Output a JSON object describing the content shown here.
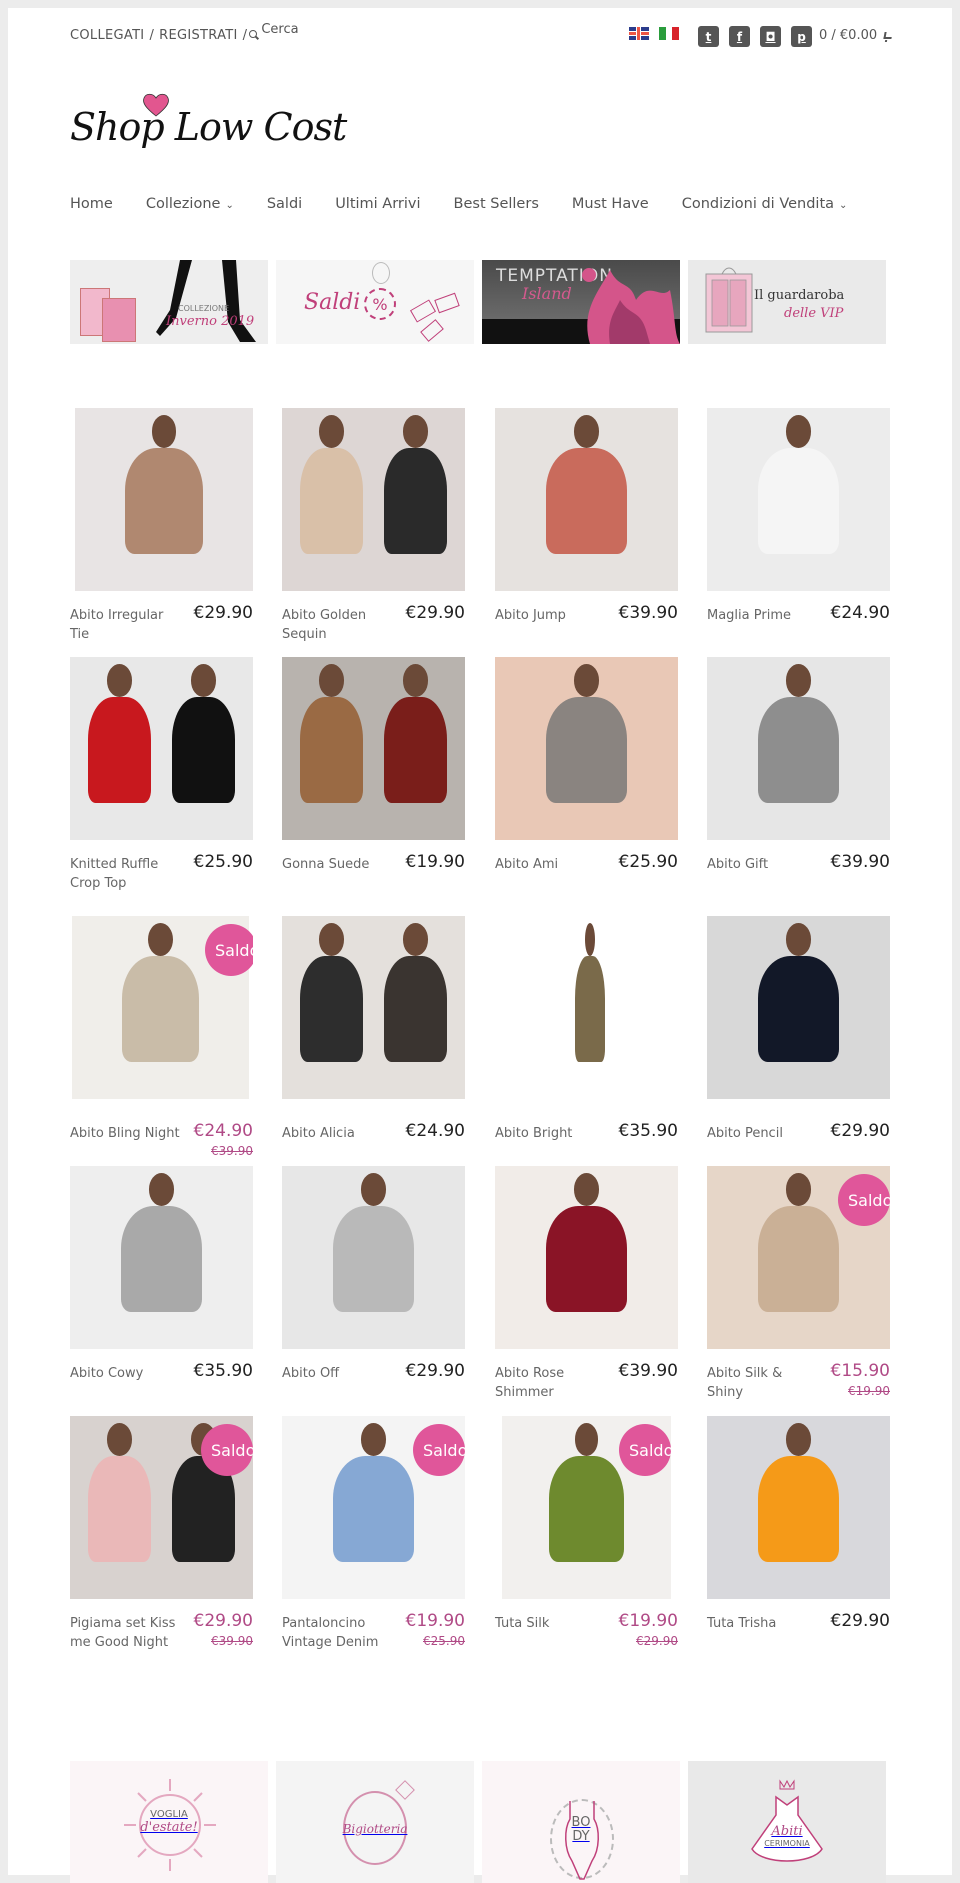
{
  "topbar": {
    "login": "COLLEGATI",
    "separator": "/",
    "register": "REGISTRATI",
    "separator2": "/",
    "search_placeholder": "Cerca",
    "flags": [
      "English",
      "Italiano"
    ],
    "socials": [
      {
        "name": "twitter",
        "glyph": "t"
      },
      {
        "name": "facebook",
        "glyph": "f"
      },
      {
        "name": "instagram",
        "glyph": "◘"
      },
      {
        "name": "pinterest",
        "glyph": "p"
      }
    ],
    "cart": "0 / €0.00"
  },
  "logo": {
    "text": "Shop Low Cost"
  },
  "nav": [
    {
      "label": "Home",
      "dropdown": false
    },
    {
      "label": "Collezione",
      "dropdown": true
    },
    {
      "label": "Saldi",
      "dropdown": false
    },
    {
      "label": "Ultimi Arrivi",
      "dropdown": false
    },
    {
      "label": "Best Sellers",
      "dropdown": false
    },
    {
      "label": "Must Have",
      "dropdown": false
    },
    {
      "label": "Condizioni di Vendita",
      "dropdown": true
    }
  ],
  "banners": [
    {
      "name": "collezione-inverno",
      "line1": "COLLEZIONE",
      "line2": "Inverno 2019"
    },
    {
      "name": "saldi",
      "line1": "Saldi",
      "line2": "%"
    },
    {
      "name": "temptation-island",
      "line1": "TEMPTATION",
      "line2": "Island"
    },
    {
      "name": "guardaroba-vip",
      "line1": "Il guardaroba",
      "line2": "delle VIP"
    }
  ],
  "sale_badge": "Saldo",
  "colors": {
    "accent": "#b04a86",
    "badge": "#e0569a",
    "text": "#555555",
    "price": "#222222"
  },
  "products": [
    {
      "name": "Abito Irregular Tie",
      "price": "€29.90",
      "sale": false
    },
    {
      "name": "Abito Golden Sequin",
      "price": "€29.90",
      "sale": false
    },
    {
      "name": "Abito Jump",
      "price": "€39.90",
      "sale": false
    },
    {
      "name": "Maglia Prime",
      "price": "€24.90",
      "sale": false
    },
    {
      "name": "Knitted Ruffle Crop Top",
      "price": "€25.90",
      "sale": false
    },
    {
      "name": "Gonna Suede",
      "price": "€19.90",
      "sale": false
    },
    {
      "name": "Abito Ami",
      "price": "€25.90",
      "sale": false
    },
    {
      "name": "Abito Gift",
      "price": "€39.90",
      "sale": false
    },
    {
      "name": "Abito Bling Night",
      "price": "€24.90",
      "old_price": "€39.90",
      "sale": true
    },
    {
      "name": "Abito Alicia",
      "price": "€24.90",
      "sale": false
    },
    {
      "name": "Abito Bright",
      "price": "€35.90",
      "sale": false
    },
    {
      "name": "Abito Pencil",
      "price": "€29.90",
      "sale": false
    },
    {
      "name": "Abito Cowy",
      "price": "€35.90",
      "sale": false
    },
    {
      "name": "Abito Off",
      "price": "€29.90",
      "sale": false
    },
    {
      "name": "Abito Rose Shimmer",
      "price": "€39.90",
      "sale": false
    },
    {
      "name": "Abito Silk & Shiny",
      "price": "€15.90",
      "old_price": "€19.90",
      "sale": true
    },
    {
      "name": "Pigiama set Kiss me Good Night",
      "price": "€29.90",
      "old_price": "€39.90",
      "sale": true
    },
    {
      "name": "Pantaloncino Vintage Denim",
      "price": "€19.90",
      "old_price": "€25.90",
      "sale": true
    },
    {
      "name": "Tuta Silk",
      "price": "€19.90",
      "old_price": "€29.90",
      "sale": true
    },
    {
      "name": "Tuta Trisha",
      "price": "€29.90",
      "sale": false
    }
  ],
  "categories": [
    {
      "name": "voglia-destate",
      "line1": "VOGLIA",
      "line2": "d'estate!"
    },
    {
      "name": "bigiotteria",
      "line1": "Bigiotteria",
      "line2": ""
    },
    {
      "name": "body",
      "line1": "BO",
      "line2": "DY"
    },
    {
      "name": "abiti-cerimonia",
      "line1": "Abiti",
      "line2": "CERIMONIA"
    }
  ]
}
